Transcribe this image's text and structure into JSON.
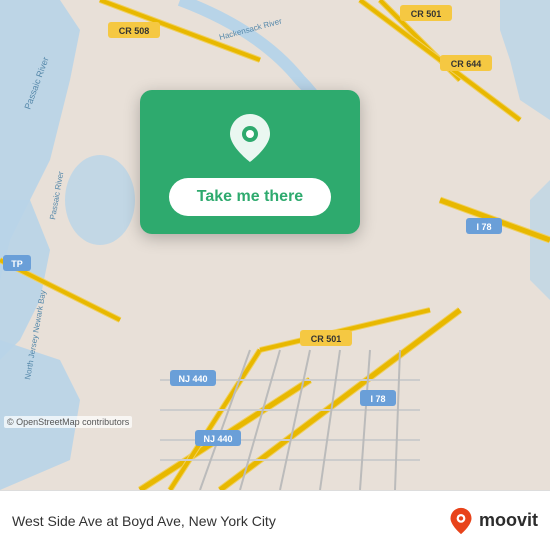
{
  "map": {
    "background_color": "#e8e0d8",
    "osm_credit": "© OpenStreetMap contributors"
  },
  "location_card": {
    "button_label": "Take me there",
    "pin_icon": "location-pin-icon"
  },
  "bottom_bar": {
    "location_name": "West Side Ave at Boyd Ave, New York City",
    "moovit_label": "moovit",
    "moovit_icon": "moovit-logo-icon"
  }
}
